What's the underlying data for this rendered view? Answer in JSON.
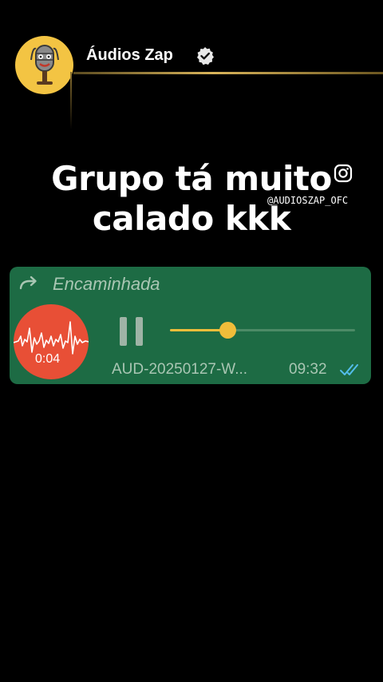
{
  "header": {
    "channel_name": "Áudios Zap",
    "avatar_icon": "microphone-mascot-icon",
    "verified_icon": "verified-badge-icon"
  },
  "caption": {
    "line1": "Grupo tá muito",
    "line2": "calado kkk"
  },
  "watermark": {
    "icon": "instagram-icon",
    "handle": "@AUDIOSZAP_OFC"
  },
  "message": {
    "forwarded_icon": "forward-arrow-icon",
    "forwarded_label": "Encaminhada",
    "audio": {
      "duration": "0:04",
      "state_icon": "pause-icon",
      "progress": 0.31,
      "filename": "AUD-20250127-W...",
      "time": "09:32",
      "status_icon": "double-check-read-icon"
    }
  },
  "colors": {
    "background": "#000000",
    "bubble": "#1d6b44",
    "accent": "#f0bd3a",
    "waveform_circle": "#e84f36",
    "read_ticks": "#53bdeb",
    "meta_text": "#a9c6b3"
  }
}
